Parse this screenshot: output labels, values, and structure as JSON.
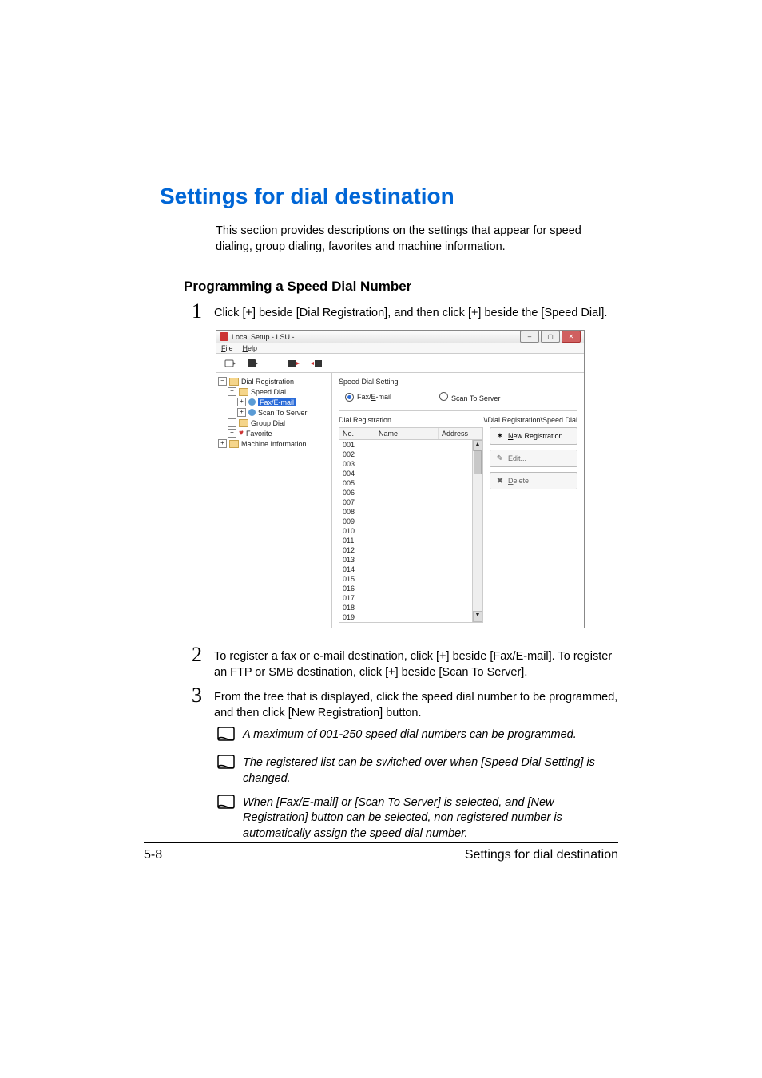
{
  "section_title": "Settings for dial destination",
  "intro": "This section provides descriptions on the settings that appear for speed dialing, group dialing, favorites and machine information.",
  "subheading": "Programming a Speed Dial Number",
  "steps": {
    "s1": {
      "num": "1",
      "text": "Click [+] beside [Dial Registration], and then click [+] beside the [Speed Dial]."
    },
    "s2": {
      "num": "2",
      "text": "To register a fax or e-mail destination, click [+] beside [Fax/E-mail]. To register an FTP or SMB destination, click [+] beside [Scan To Server]."
    },
    "s3": {
      "num": "3",
      "text": "From the tree that is displayed, click the speed dial number to be programmed, and then click [New Registration] button."
    }
  },
  "notes": {
    "n1": "A maximum of 001-250 speed dial numbers can be programmed.",
    "n2": "The registered list can be switched over when [Speed Dial Setting] is changed.",
    "n3": "When [Fax/E-mail] or [Scan To Server] is selected, and [New Registration] button can be selected, non registered number is automatically assign the speed dial number."
  },
  "footer": {
    "left": "5-8",
    "right": "Settings for dial destination"
  },
  "app": {
    "title": "Local Setup - LSU -",
    "menu": {
      "file": "File",
      "help": "Help"
    },
    "tree": {
      "dial_registration": "Dial Registration",
      "speed_dial": "Speed Dial",
      "fax_email": "Fax/E-mail",
      "scan_to_server": "Scan To Server",
      "group_dial": "Group Dial",
      "favorite": "Favorite",
      "machine_information": "Machine Information"
    },
    "panel": {
      "speed_dial_setting": "Speed Dial Setting",
      "fax_email": "Fax/E-mail",
      "scan_to_server": "Scan To Server",
      "dial_registration": "Dial Registration",
      "path": "\\\\Dial Registration\\Speed Dial",
      "cols": {
        "no": "No.",
        "name": "Name",
        "address": "Address"
      },
      "rows": [
        "001",
        "002",
        "003",
        "004",
        "005",
        "006",
        "007",
        "008",
        "009",
        "010",
        "011",
        "012",
        "013",
        "014",
        "015",
        "016",
        "017",
        "018",
        "019"
      ],
      "buttons": {
        "new": "New Registration...",
        "edit": "Edit...",
        "delete": "Delete"
      }
    }
  }
}
